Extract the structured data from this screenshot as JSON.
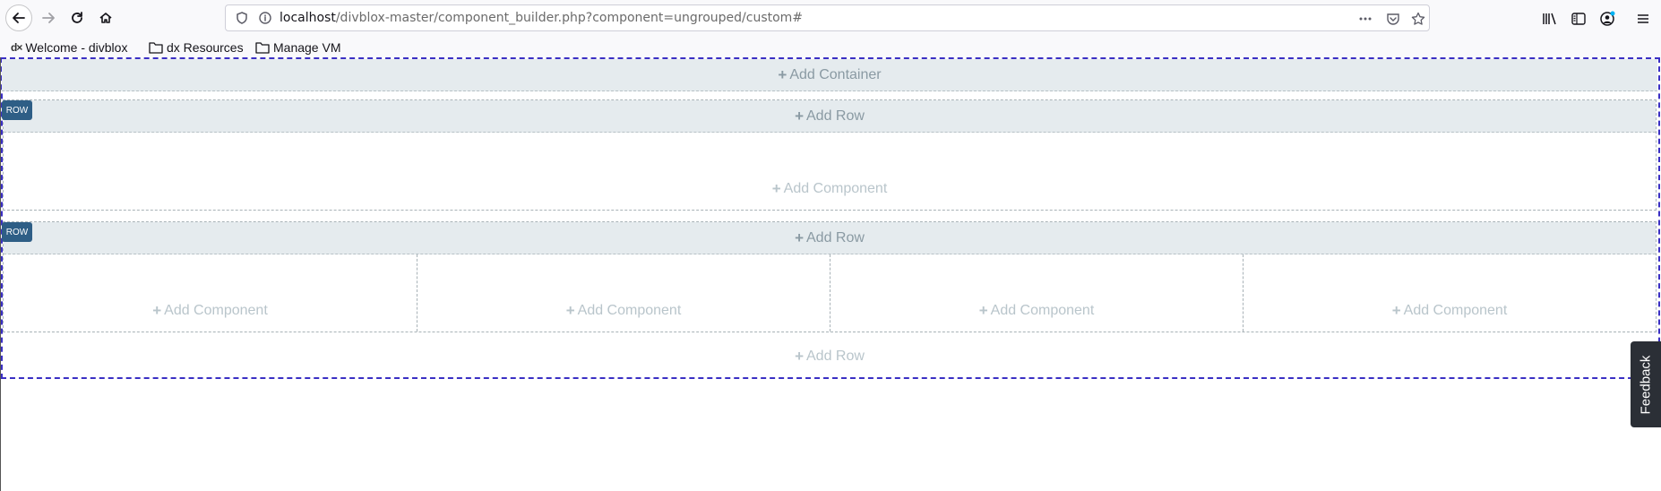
{
  "browser": {
    "url_host": "localhost",
    "url_path": "/divblox-master/component_builder.php?component=ungrouped/custom#",
    "icons": {
      "back": "arrow-left-icon",
      "forward": "arrow-right-icon",
      "reload": "reload-icon",
      "home": "home-icon",
      "shield": "shield-icon",
      "info": "info-icon",
      "more": "more-horizontal-icon",
      "pocket": "pocket-icon",
      "star": "star-icon",
      "library": "library-icon",
      "sidebar": "sidebar-icon",
      "account": "account-icon",
      "menu": "hamburger-menu-icon"
    }
  },
  "bookmarks": [
    {
      "label": "Welcome - divblox",
      "icon": "dx-logo-icon"
    },
    {
      "label": "dx Resources",
      "icon": "folder-icon"
    },
    {
      "label": "Manage VM",
      "icon": "folder-icon"
    }
  ],
  "builder": {
    "add_container": "Add Container",
    "rows": [
      {
        "tag": "ROW",
        "add_row": "Add Row",
        "columns": [
          {
            "add_component": "Add Component"
          }
        ]
      },
      {
        "tag": "ROW",
        "add_row": "Add Row",
        "columns": [
          {
            "add_component": "Add Component"
          },
          {
            "add_component": "Add Component"
          },
          {
            "add_component": "Add Component"
          },
          {
            "add_component": "Add Component"
          }
        ]
      }
    ],
    "add_row_bottom": "Add Row"
  },
  "feedback": {
    "label": "Feedback"
  },
  "colors": {
    "container_border": "#3a2fc4",
    "row_tag_bg": "#2e5e86",
    "bar_bg": "#e5ebee",
    "feedback_bg": "#2b2f36"
  }
}
